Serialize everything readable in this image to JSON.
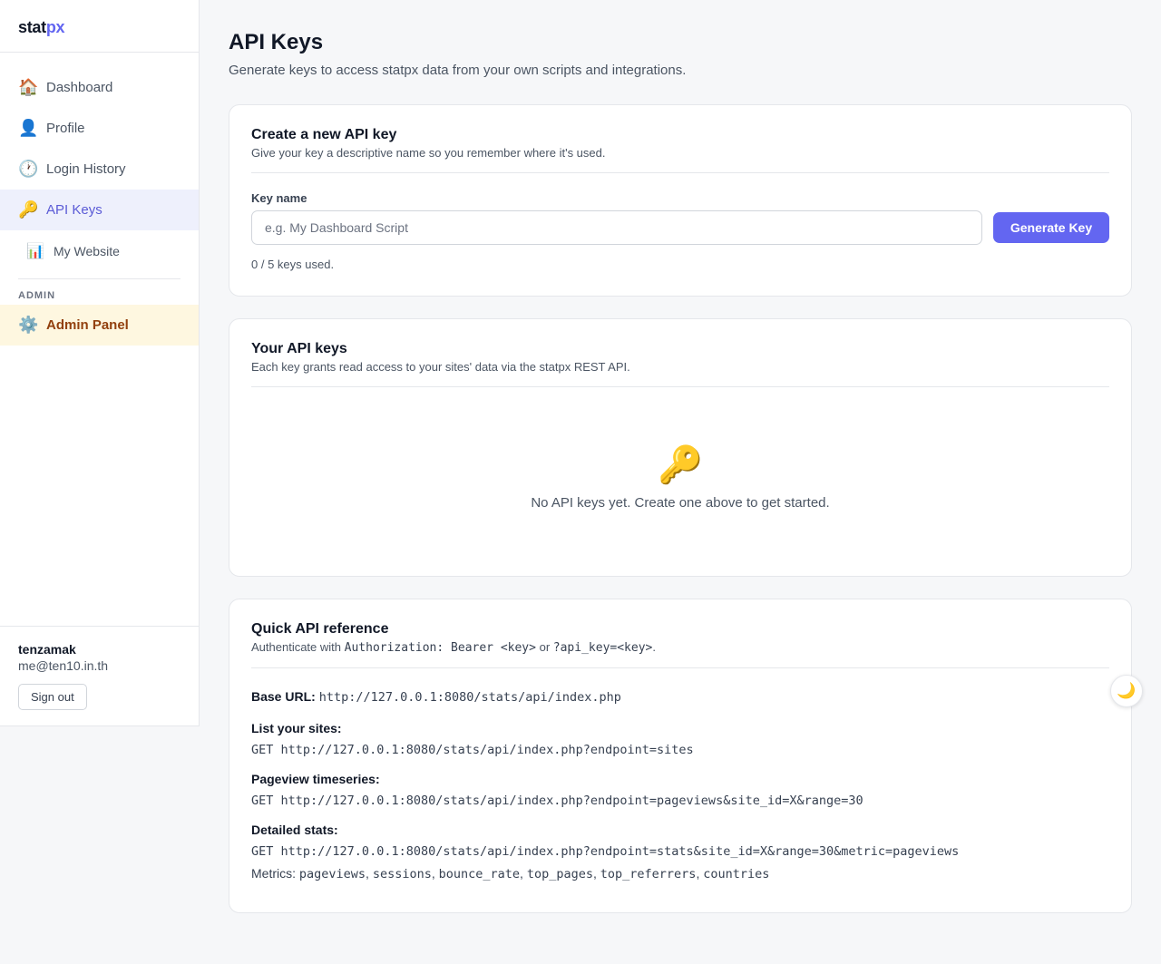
{
  "brand": {
    "part1": "stat",
    "part2": "px",
    "accent_color": "#6366f1"
  },
  "sidebar": {
    "items": [
      {
        "label": "Dashboard",
        "icon": "house-icon",
        "glyph": "🏠"
      },
      {
        "label": "Profile",
        "icon": "user-icon",
        "glyph": "👤"
      },
      {
        "label": "Login History",
        "icon": "clock-icon",
        "glyph": "🕐"
      },
      {
        "label": "API Keys",
        "icon": "key-icon",
        "glyph": "🔑",
        "active": true
      },
      {
        "label": "My Website",
        "icon": "chart-icon",
        "glyph": "📊"
      }
    ],
    "section_label": "ADMIN",
    "admin_item": {
      "label": "Admin Panel",
      "icon": "gear-icon",
      "glyph": "⚙️"
    },
    "user": {
      "name": "tenzamak",
      "email": "me@ten10.in.th",
      "signout_label": "Sign out"
    }
  },
  "page": {
    "title": "API Keys",
    "subtitle": "Generate keys to access statpx data from your own scripts and integrations."
  },
  "create_card": {
    "title": "Create a new API key",
    "subtitle": "Give your key a descriptive name so you remember where it's used.",
    "field_label": "Key name",
    "placeholder": "e.g. My Dashboard Script",
    "value": "",
    "button_label": "Generate Key",
    "usage": "0 / 5 keys used."
  },
  "keys_card": {
    "title": "Your API keys",
    "subtitle": "Each key grants read access to your sites' data via the statpx REST API.",
    "empty_icon": "🔑",
    "empty_text": "No API keys yet. Create one above to get started."
  },
  "reference_card": {
    "title": "Quick API reference",
    "auth_prefix": "Authenticate with",
    "auth_header": "Authorization: Bearer <key>",
    "auth_or": "or",
    "auth_param": "?api_key=<key>",
    "auth_suffix": ".",
    "base_label": "Base URL:",
    "base_url": "http://127.0.0.1:8080/stats/api/index.php",
    "sections": [
      {
        "label": "List your sites:",
        "method": "GET",
        "url": "http://127.0.0.1:8080/stats/api/index.php?endpoint=sites"
      },
      {
        "label": "Pageview timeseries:",
        "method": "GET",
        "url": "http://127.0.0.1:8080/stats/api/index.php?endpoint=pageviews&site_id=X&range=30"
      },
      {
        "label": "Detailed stats:",
        "method": "GET",
        "url": "http://127.0.0.1:8080/stats/api/index.php?endpoint=stats&site_id=X&range=30&metric=pageviews"
      }
    ],
    "metrics_label": "Metrics:",
    "metrics": [
      "pageviews",
      "sessions",
      "bounce_rate",
      "top_pages",
      "top_referrers",
      "countries"
    ]
  },
  "theme_toggle": {
    "icon": "moon-icon",
    "glyph": "🌙"
  }
}
